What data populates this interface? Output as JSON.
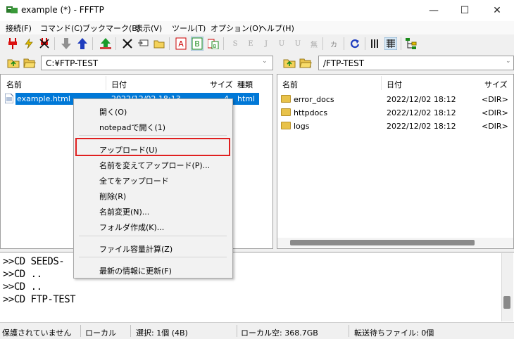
{
  "window": {
    "title": "example (*) - FFFTP",
    "minimize": "—",
    "maximize": "☐",
    "close": "✕"
  },
  "menu": [
    "接続(F)",
    "コマンド(C)",
    "ブックマーク(B)",
    "表示(V)",
    "ツール(T)",
    "オプション(O)",
    "ヘルプ(H)"
  ],
  "toolbar": {
    "letters": [
      "S",
      "E",
      "J",
      "U",
      "U",
      "無",
      "カ"
    ]
  },
  "local": {
    "path": "C:¥FTP-TEST",
    "columns": {
      "name": "名前",
      "date": "日付",
      "size": "サイズ",
      "type": "種類"
    },
    "files": [
      {
        "name": "example.html",
        "date": "2022/12/02 18:13",
        "size": "4",
        "type": "html"
      }
    ]
  },
  "remote": {
    "path": "/FTP-TEST",
    "columns": {
      "name": "名前",
      "date": "日付",
      "size": "サイズ"
    },
    "files": [
      {
        "name": "error_docs",
        "date": "2022/12/02 18:12",
        "size": "<DIR>"
      },
      {
        "name": "httpdocs",
        "date": "2022/12/02 18:12",
        "size": "<DIR>"
      },
      {
        "name": "logs",
        "date": "2022/12/02 18:12",
        "size": "<DIR>"
      }
    ]
  },
  "context_menu": {
    "items": [
      "開く(O)",
      "notepadで開く(1)",
      "アップロード(U)",
      "名前を変えてアップロード(P)...",
      "全てをアップロード",
      "削除(R)",
      "名前変更(N)...",
      "フォルダ作成(K)...",
      "ファイル容量計算(Z)",
      "最新の情報に更新(F)"
    ],
    "highlighted_index": 2,
    "highlight_color": "#e02020"
  },
  "log": [
    ">>CD SEEDS-",
    ">>CD ..",
    ">>CD ..",
    ">>CD FTP-TEST"
  ],
  "status": {
    "security": "保護されていません",
    "mode": "ローカル",
    "selection": "選択: 1個 (4B)",
    "free": "ローカル空: 368.7GB",
    "queue": "転送待ちファイル: 0個"
  },
  "colors": {
    "selection": "#0078d7",
    "highlight_box": "#e02020"
  }
}
